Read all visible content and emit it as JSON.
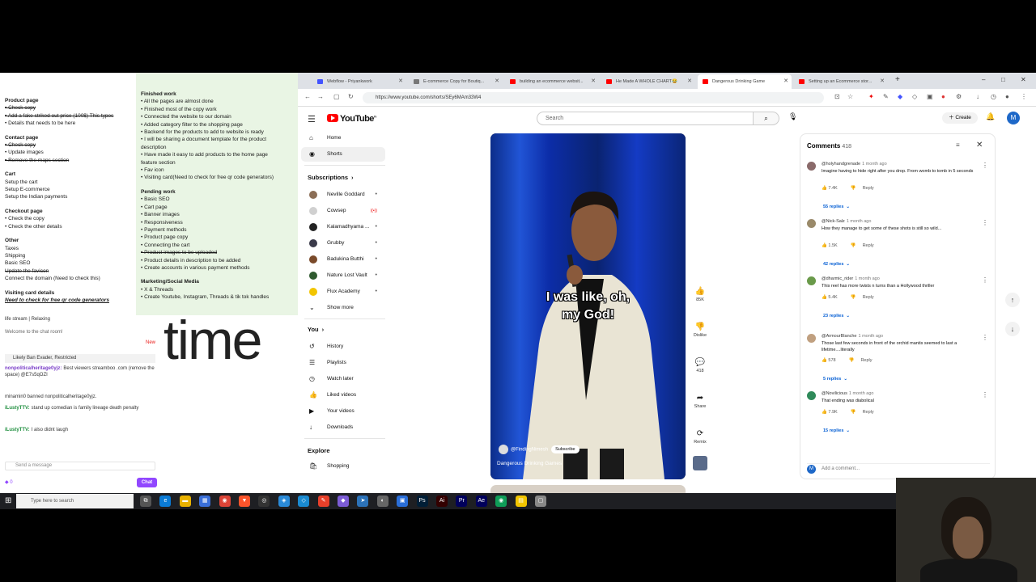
{
  "notes": {
    "col1": [
      {
        "type": "h",
        "text": "Product page"
      },
      {
        "type": "li",
        "text": "• Check copy",
        "strike": true
      },
      {
        "type": "li",
        "text": "• Add a fake striked out price (100$) This types",
        "strike": true
      },
      {
        "type": "li",
        "text": "• Details that needs to be here"
      },
      {
        "type": "h",
        "text": "Contact page"
      },
      {
        "type": "li",
        "text": "• Check copy",
        "strike": true
      },
      {
        "type": "li",
        "text": "• Update images"
      },
      {
        "type": "li",
        "text": "• Remove the maps section",
        "strike": true
      },
      {
        "type": "h",
        "text": "Cart"
      },
      {
        "type": "li",
        "text": "Setup the cart"
      },
      {
        "type": "li",
        "text": "Setup E-commerce"
      },
      {
        "type": "li",
        "text": "Setup the Indian payments"
      },
      {
        "type": "h",
        "text": "Checkout page"
      },
      {
        "type": "li",
        "text": "• Check the copy"
      },
      {
        "type": "li",
        "text": "• Check the other details"
      },
      {
        "type": "h",
        "text": "Other"
      },
      {
        "type": "li",
        "text": "Taxes"
      },
      {
        "type": "li",
        "text": "Shipping"
      },
      {
        "type": "li",
        "text": "Basic SEO"
      },
      {
        "type": "li",
        "text": "Update the favicon",
        "strike": true
      },
      {
        "type": "li",
        "text": "Connect the domain (Need to check this)"
      },
      {
        "type": "h",
        "text": "Visiting card details"
      },
      {
        "type": "u",
        "text": "Need to check for free qr code generators"
      }
    ],
    "col2": [
      {
        "type": "h",
        "text": "Finished work"
      },
      {
        "type": "li",
        "text": "• All the pages are almost done"
      },
      {
        "type": "li",
        "text": "• Finished most of the copy work"
      },
      {
        "type": "li",
        "text": "• Connected the website to our domain"
      },
      {
        "type": "li",
        "text": "• Added category filter to the shopping page"
      },
      {
        "type": "li",
        "text": "• Backend for the products to add to website is ready"
      },
      {
        "type": "li",
        "text": "• I will be sharing a document template for the product"
      },
      {
        "type": "li",
        "text": "description"
      },
      {
        "type": "li",
        "text": "• Have made it easy to add products to the home page"
      },
      {
        "type": "li",
        "text": "feature section"
      },
      {
        "type": "li",
        "text": "• Fav icon"
      },
      {
        "type": "li",
        "text": "• Visiting card(Need to check for free qr code generators)"
      },
      {
        "type": "h",
        "text": "Pending work"
      },
      {
        "type": "li",
        "text": "• Basic SEO"
      },
      {
        "type": "li",
        "text": "• Cart page"
      },
      {
        "type": "li",
        "text": "• Banner images"
      },
      {
        "type": "li",
        "text": "• Responsiveness"
      },
      {
        "type": "li",
        "text": "• Payment methods"
      },
      {
        "type": "li",
        "text": "• Product page copy"
      },
      {
        "type": "li",
        "text": "• Connecting the cart"
      },
      {
        "type": "li",
        "text": "• Product images to be uploaded",
        "strike": true
      },
      {
        "type": "li",
        "text": "• Product details in description to be added"
      },
      {
        "type": "li",
        "text": "• Create accounts in various payment methods"
      },
      {
        "type": "h",
        "text": "Marketing/Social Media"
      },
      {
        "type": "li",
        "text": "• X & Threads"
      },
      {
        "type": "li",
        "text": "• Create Youtube, Instagram, Threads & tik tok handles"
      }
    ]
  },
  "chat": {
    "stream_title": "life stream | Relaxing",
    "welcome": "Welcome to the chat room!",
    "new_badge": "New",
    "pinned_user": "Likely Ban Evader, Restricted",
    "messages": [
      {
        "user": "nonpoliticalheritage0yjz:",
        "text": "Best viewers streamboo .com (remove the space) @E7s5qOZI",
        "user_color": "#7a3ec8"
      },
      {
        "user": "",
        "text": "minamin0 banned nonpoliticalheritage0yjz.",
        "user_color": "#555"
      },
      {
        "user": "iLustyTTV:",
        "text": "stand up comedian is family lineage death penalty",
        "user_color": "#1e8e3e"
      },
      {
        "user": "iLustyTTV:",
        "text": "I also didnt laugh",
        "user_color": "#1e8e3e"
      }
    ],
    "input_placeholder": "Send a message",
    "bits": "0",
    "chat_button": "Chat"
  },
  "overlay_word": "time",
  "browser": {
    "tabs": [
      {
        "label": "Webflow - Priyankwork",
        "color": "#4353ff",
        "active": false
      },
      {
        "label": "E-commerce Copy for Boutiq...",
        "color": "#777",
        "active": false
      },
      {
        "label": "building an ecommerce websit...",
        "color": "#f00",
        "active": false
      },
      {
        "label": "He Made A WHOLE CHART😂",
        "color": "#f00",
        "active": false
      },
      {
        "label": "Dangerous Drinking Game",
        "color": "#f00",
        "active": true
      },
      {
        "label": "Setting up an Ecommerce stor...",
        "color": "#f00",
        "active": false
      }
    ],
    "url": "https://www.youtube.com/shorts/SEy6MAm33W4"
  },
  "youtube": {
    "logo_text": "YouTube",
    "logo_region": "IN",
    "search_placeholder": "Search",
    "create_label": "Create",
    "avatar_letter": "M",
    "nav": [
      {
        "label": "Home",
        "icon": "⌂",
        "active": false
      },
      {
        "label": "Shorts",
        "icon": "◉",
        "active": true
      }
    ],
    "subscriptions_header": "Subscriptions",
    "subscriptions": [
      {
        "label": "Neville Goddard",
        "avatar_color": "#8b6e56",
        "dot": "•"
      },
      {
        "label": "Cowsep",
        "avatar_color": "#d0d0d0",
        "dot": "((•))"
      },
      {
        "label": "Kalamadhyama ...",
        "avatar_color": "#222",
        "dot": "•"
      },
      {
        "label": "Grubby",
        "avatar_color": "#3a3a4a",
        "dot": "•"
      },
      {
        "label": "Badukina Butthi",
        "avatar_color": "#7a4a2a",
        "dot": "•"
      },
      {
        "label": "Nature Lost Vault",
        "avatar_color": "#2f5a2f",
        "dot": "•"
      },
      {
        "label": "Flux Academy",
        "avatar_color": "#f2c500",
        "dot": "•"
      }
    ],
    "show_more": "Show more",
    "you_header": "You",
    "you_items": [
      {
        "label": "History",
        "icon": "↺"
      },
      {
        "label": "Playlists",
        "icon": "☰"
      },
      {
        "label": "Watch later",
        "icon": "◷"
      },
      {
        "label": "Liked videos",
        "icon": "👍"
      },
      {
        "label": "Your videos",
        "icon": "▶"
      },
      {
        "label": "Downloads",
        "icon": "↓"
      }
    ],
    "explore_header": "Explore",
    "explore_items": [
      {
        "label": "Shopping",
        "icon": "🛍"
      }
    ],
    "video": {
      "caption_line1": "I was like, oh,",
      "caption_line2": "my God!",
      "channel": "@FindingNimesh",
      "subscribe": "Subscribe",
      "title": "Dangerous Drinking Games"
    },
    "actions": [
      {
        "name": "like",
        "icon": "👍",
        "label": "85K"
      },
      {
        "name": "dislike",
        "icon": "👎",
        "label": "Dislike"
      },
      {
        "name": "comments",
        "icon": "💬",
        "label": "418"
      },
      {
        "name": "share",
        "icon": "➦",
        "label": "Share"
      },
      {
        "name": "remix",
        "icon": "⟳",
        "label": "Remix"
      }
    ],
    "comments": {
      "title": "Comments",
      "count": "418",
      "add_placeholder": "Add a comment...",
      "items": [
        {
          "user": "@holyhandgrenade",
          "time": "1 month ago",
          "text": "Imagine having to hide right after you drop. From womb to tomb in 5 seconds",
          "likes": "7.4K",
          "reply": "Reply",
          "replies": "55 replies",
          "av": "#8a6a6a"
        },
        {
          "user": "@Nick-Salz",
          "time": "1 month ago",
          "text": "How they manage to get some of these shots is still so wild...",
          "likes": "1.5K",
          "reply": "Reply",
          "replies": "42 replies",
          "av": "#9a8a6a"
        },
        {
          "user": "@dharmic_rider",
          "time": "1 month ago",
          "text": "This reel has more twists n turns than a Hollywood thriller",
          "likes": "5.4K",
          "reply": "Reply",
          "replies": "23 replies",
          "av": "#6a9a4a"
        },
        {
          "user": "@ArmourBlanche",
          "time": "1 month ago",
          "text": "Those last few seconds in front of the orchid mantis seemed to last a lifetime....literally",
          "likes": "578",
          "reply": "Reply",
          "replies": "5 replies",
          "av": "#c0a080"
        },
        {
          "user": "@Novilicious",
          "time": "1 month ago",
          "text": "That ending was diabolical",
          "likes": "7.9K",
          "reply": "Reply",
          "replies": "15 replies",
          "av": "#2f8a5a"
        }
      ]
    }
  },
  "taskbar": {
    "search_placeholder": "Type here to search"
  }
}
